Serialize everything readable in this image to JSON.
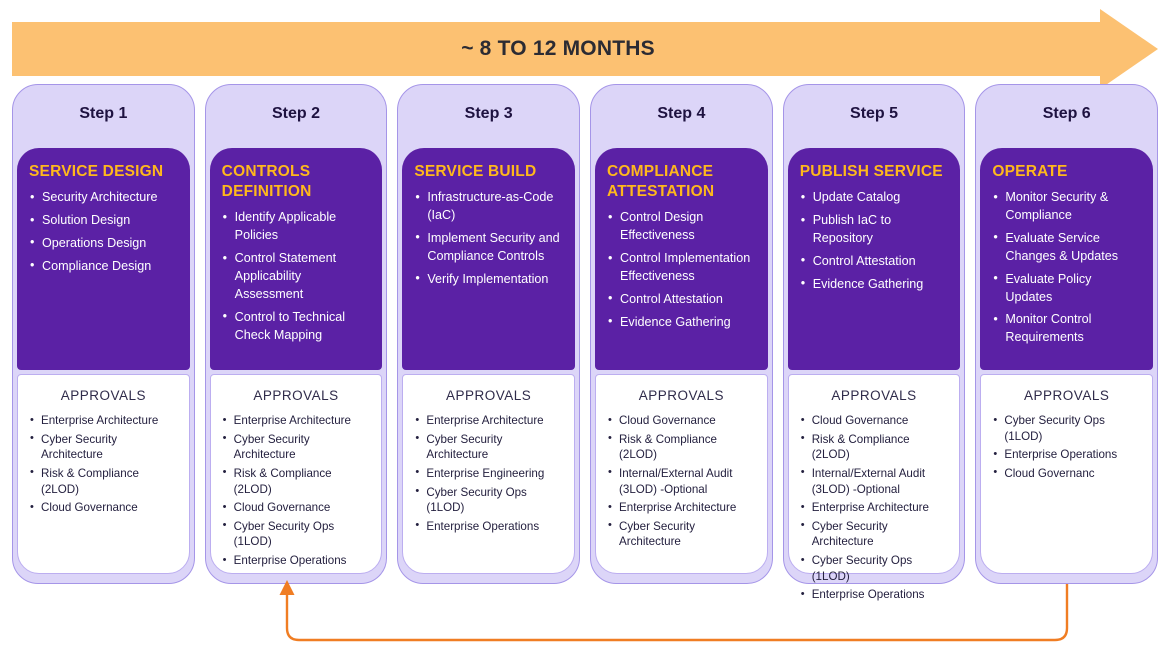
{
  "banner": {
    "label": "~ 8 TO 12 MONTHS",
    "color": "#FCC172",
    "text_color": "#2B2B33"
  },
  "colors": {
    "lavender_card": "#DCD5F8",
    "lavender_border": "#A595E8",
    "deep_purple": "#5B21A5",
    "gold_heading": "#FFB81C",
    "approvals_bg": "#FFFFFF",
    "feedback_arrow": "#F07D23",
    "step_title": "#1E1240"
  },
  "approvals_heading": "APPROVALS",
  "feedback_loop": {
    "from": "Step 6",
    "to": "Step 2",
    "color": "#F07D23"
  },
  "steps": [
    {
      "step_label": "Step 1",
      "heading": "SERVICE DESIGN",
      "activities": [
        "Security Architecture",
        "Solution Design",
        "Operations Design",
        "Compliance Design"
      ],
      "approvals": [
        "Enterprise Architecture",
        "Cyber Security Architecture",
        "Risk & Compliance (2LOD)",
        "Cloud Governance"
      ]
    },
    {
      "step_label": "Step 2",
      "heading": "CONTROLS DEFINITION",
      "activities": [
        "Identify Applicable Policies",
        "Control Statement Applicability Assessment",
        "Control to Technical Check Mapping"
      ],
      "approvals": [
        "Enterprise Architecture",
        "Cyber Security Architecture",
        "Risk & Compliance (2LOD)",
        "Cloud Governance",
        "Cyber Security Ops (1LOD)",
        "Enterprise Operations"
      ]
    },
    {
      "step_label": "Step 3",
      "heading": "SERVICE BUILD",
      "activities": [
        "Infrastructure-as-Code (IaC)",
        "Implement Security and Compliance Controls",
        "Verify Implementation"
      ],
      "approvals": [
        "Enterprise Architecture",
        "Cyber Security Architecture",
        "Enterprise Engineering",
        "Cyber Security Ops (1LOD)",
        "Enterprise Operations"
      ]
    },
    {
      "step_label": "Step 4",
      "heading": "COMPLIANCE ATTESTATION",
      "activities": [
        "Control Design Effectiveness",
        "Control Implementation Effectiveness",
        "Control Attestation",
        "Evidence Gathering"
      ],
      "approvals": [
        "Cloud Governance",
        "Risk & Compliance (2LOD)",
        "Internal/External Audit (3LOD) -Optional",
        "Enterprise Architecture",
        "Cyber Security Architecture"
      ]
    },
    {
      "step_label": "Step 5",
      "heading": "PUBLISH SERVICE",
      "activities": [
        "Update Catalog",
        "Publish IaC to Repository",
        "Control Attestation",
        "Evidence Gathering"
      ],
      "approvals": [
        "Cloud Governance",
        "Risk & Compliance (2LOD)",
        "Internal/External Audit (3LOD) -Optional",
        "Enterprise Architecture",
        "Cyber Security Architecture",
        "Cyber Security Ops (1LOD)",
        "Enterprise Operations"
      ]
    },
    {
      "step_label": "Step 6",
      "heading": "OPERATE",
      "activities": [
        "Monitor Security & Compliance",
        "Evaluate Service Changes & Updates",
        "Evaluate Policy Updates",
        "Monitor Control Requirements"
      ],
      "approvals": [
        "Cyber Security Ops (1LOD)",
        "Enterprise Operations",
        "Cloud Governanc"
      ]
    }
  ]
}
